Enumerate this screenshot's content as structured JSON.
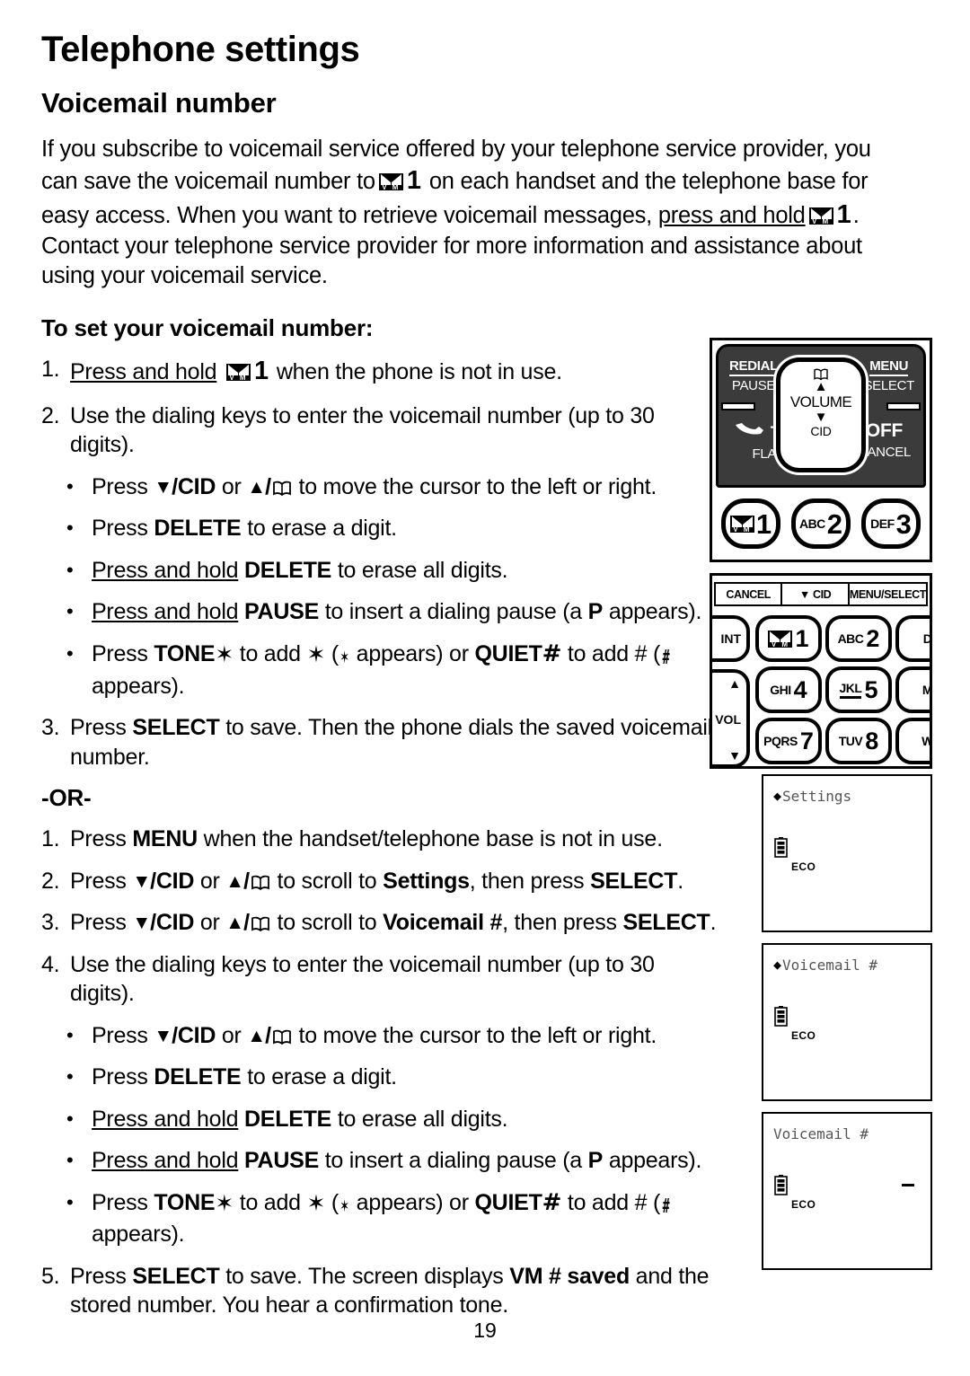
{
  "page": {
    "title": "Telephone settings",
    "section_title": "Voicemail number",
    "page_number": "19"
  },
  "intro": {
    "p1_a": "If you subscribe to voicemail service offered by your telephone service provider, you can save the voicemail number to",
    "p1_b": "1",
    "p1_c": "on each handset and the telephone base for easy access. When you want to retrieve voicemail messages,",
    "p1_d": "press and hold",
    "p1_e": "1",
    "p1_f": ". Contact your telephone service provider for more information and assistance about using your voicemail service."
  },
  "howto": {
    "heading": "To set your voicemail number:",
    "step1": {
      "num": "1.",
      "a": "Press and hold",
      "b": "1",
      "c": "when the phone is not in use."
    },
    "step2": {
      "num": "2.",
      "text": "Use the dialing keys to enter the voicemail number (up to 30 digits)."
    },
    "bullets": [
      {
        "a": "Press",
        "key1": "/CID",
        "b": "or",
        "key2": "/",
        "c": "to move the cursor to the left or right."
      },
      {
        "a": "Press",
        "key": "DELETE",
        "b": "to erase a digit."
      },
      {
        "a": "Press and hold",
        "key": "DELETE",
        "b": "to erase all digits."
      },
      {
        "a": "Press and hold",
        "key": "PAUSE",
        "b": "to insert a dialing pause (a",
        "ind": "P",
        "c": "appears)."
      },
      {
        "a": "Press",
        "key1": "TONE",
        "b": "to add",
        "c": "(",
        "d": "appears) or",
        "key2": "QUIET",
        "e": "to add # (",
        "f": "appears)."
      }
    ],
    "step3": {
      "num": "3.",
      "a": "Press",
      "key": "SELECT",
      "b": "to save. Then the phone dials the saved voicemail number."
    }
  },
  "or_label": "-OR-",
  "alt": {
    "step1": {
      "num": "1.",
      "a": "Press",
      "key": "MENU",
      "b": "when the handset/telephone base is not in use."
    },
    "step2": {
      "num": "2.",
      "a": "Press",
      "key1": "/CID",
      "b": "or",
      "key2": "/",
      "c": "to scroll to",
      "target": "Settings",
      "d": ", then press",
      "key3": "SELECT",
      "e": "."
    },
    "step3": {
      "num": "3.",
      "a": "Press",
      "key1": "/CID",
      "b": "or",
      "key2": "/",
      "c": "to scroll to",
      "target": "Voicemail #",
      "d": ", then press",
      "key3": "SELECT",
      "e": "."
    },
    "step4": {
      "num": "4.",
      "text": "Use the dialing keys to enter the voicemail number (up to 30 digits)."
    },
    "bullets": [
      {
        "a": "Press",
        "key1": "/CID",
        "b": "or",
        "key2": "/",
        "c": "to move the cursor to the left or right."
      },
      {
        "a": "Press",
        "key": "DELETE",
        "b": "to erase a digit."
      },
      {
        "a": "Press and hold",
        "key": "DELETE",
        "b": "to erase all digits."
      },
      {
        "a": "Press and hold",
        "key": "PAUSE",
        "b": "to insert a dialing pause (a",
        "ind": "P",
        "c": "appears)."
      },
      {
        "a": "Press",
        "key1": "TONE",
        "b": "to add",
        "c": "(",
        "d": "appears) or",
        "key2": "QUIET",
        "e": "to add # (",
        "f": "appears)."
      }
    ],
    "step5": {
      "num": "5.",
      "a": "Press",
      "key": "SELECT",
      "b": "to save. The screen displays",
      "vm": "VM #",
      "saved": "saved",
      "c": "and the stored number. You hear a confirmation tone."
    }
  },
  "figures": {
    "handset": {
      "redial": "REDIAL",
      "pause": "PAUSE",
      "menu": "MENU",
      "select": "SELECT",
      "talk": "TALK",
      "flash": "FLASH",
      "off": "OFF",
      "cancel": "CANCEL",
      "volume": "VOLUME",
      "cid": "CID",
      "keys": [
        {
          "alpha": "",
          "digit": "1",
          "icon": "voicemail-envelope-icon"
        },
        {
          "alpha": "ABC",
          "digit": "2",
          "icon": ""
        },
        {
          "alpha": "DEF",
          "digit": "3",
          "icon": ""
        }
      ]
    },
    "base": {
      "softkeys": [
        "CANCEL",
        "CID",
        "MENU/SELECT"
      ],
      "softkey_cid_arrow": "▼",
      "int_label": "INT",
      "vol_label": "VOL",
      "keys": [
        {
          "alpha": "",
          "digit": "1",
          "icon": "voicemail-envelope-icon"
        },
        {
          "alpha": "ABC",
          "digit": "2",
          "icon": ""
        },
        {
          "alpha": "D",
          "digit": "",
          "icon": ""
        },
        {
          "alpha": "GHI",
          "digit": "4",
          "icon": ""
        },
        {
          "alpha": "JKL",
          "digit": "5",
          "icon": ""
        },
        {
          "alpha": "M",
          "digit": "",
          "icon": ""
        },
        {
          "alpha": "PQRS",
          "digit": "7",
          "icon": ""
        },
        {
          "alpha": "TUV",
          "digit": "8",
          "icon": ""
        },
        {
          "alpha": "W",
          "digit": "",
          "icon": ""
        }
      ]
    },
    "lcd_screens": [
      {
        "title": "Settings",
        "marker": "◆",
        "eco": "ECO",
        "cursor": false
      },
      {
        "title": "Voicemail #",
        "marker": "◆",
        "eco": "ECO",
        "cursor": false
      },
      {
        "title": "Voicemail #",
        "marker": "",
        "eco": "ECO",
        "cursor": true
      }
    ]
  },
  "colors": {
    "page_bg": "#ffffff",
    "ink": "#000000",
    "handset_panel": "#3b3b3b",
    "lcd_text": "#555555"
  }
}
